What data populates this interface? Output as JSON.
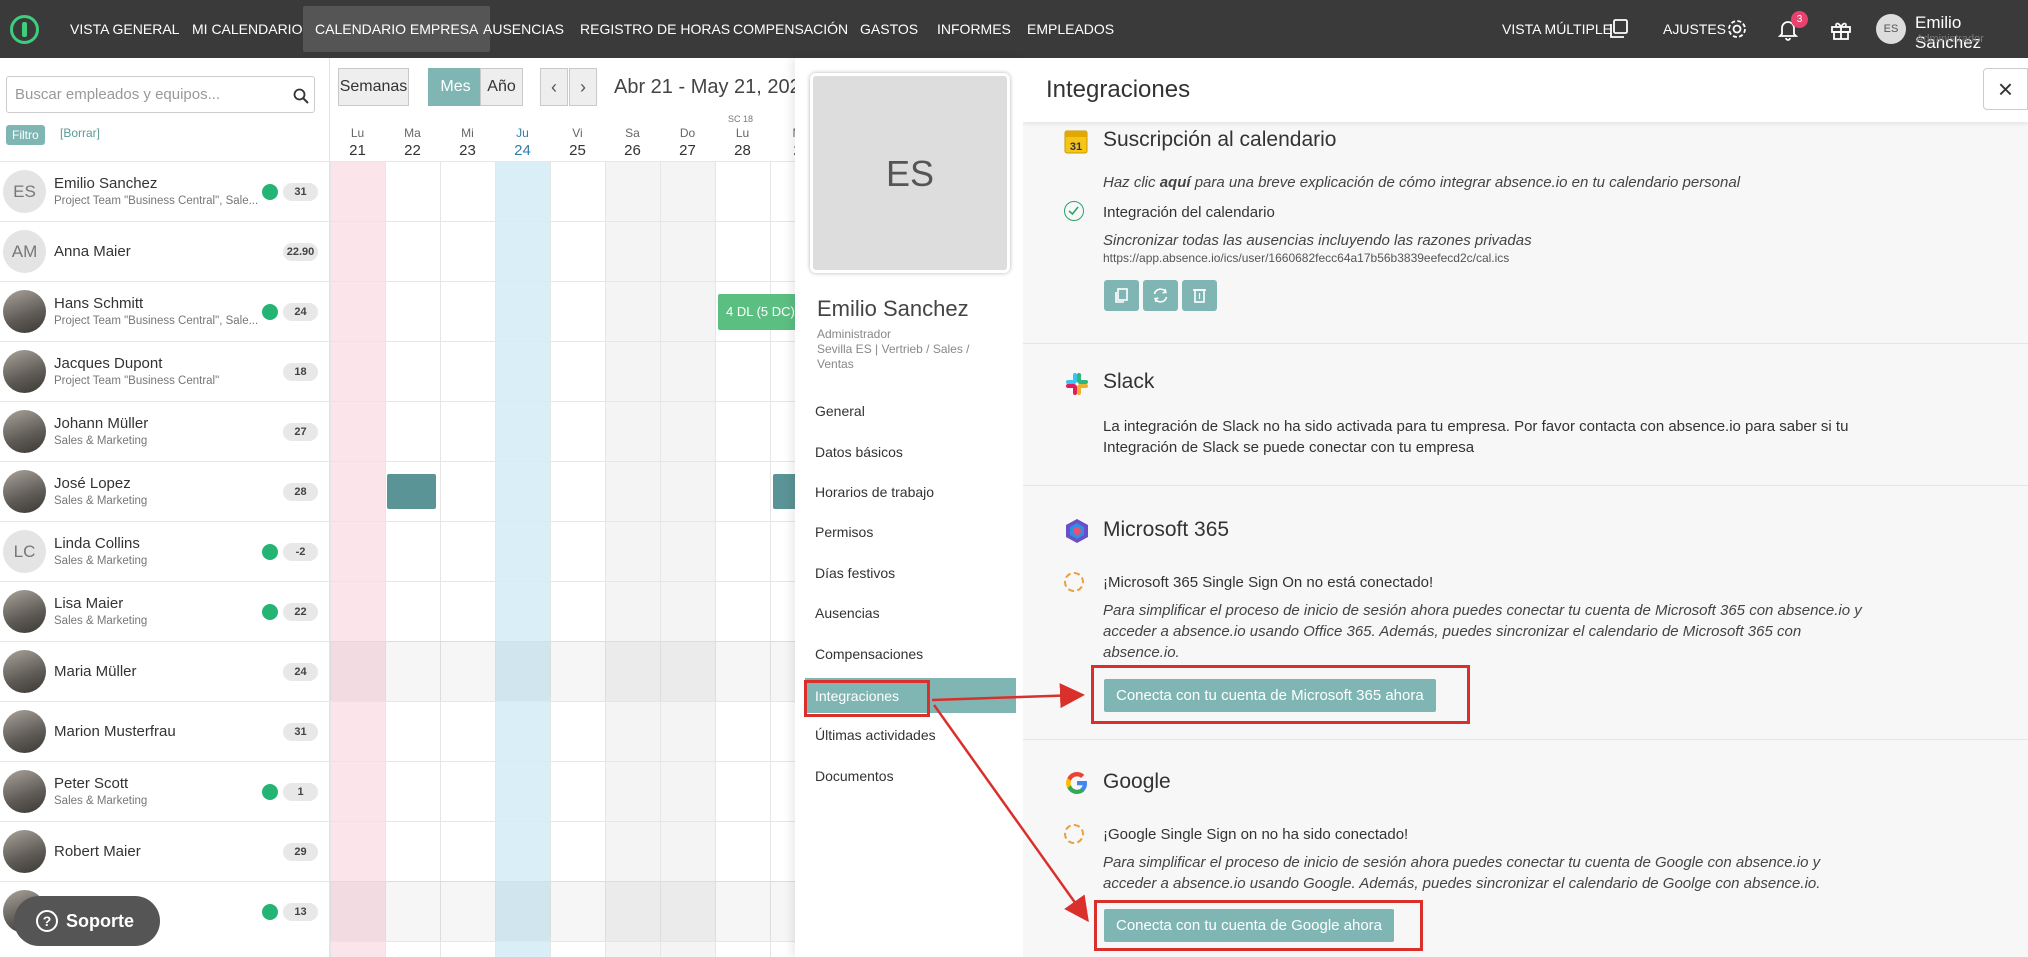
{
  "topbar": {
    "nav": [
      "VISTA GENERAL",
      "MI CALENDARIO",
      "CALENDARIO EMPRESA",
      "AUSENCIAS",
      "REGISTRO DE HORAS",
      "COMPENSACIÓN",
      "GASTOS",
      "INFORMES",
      "EMPLEADOS"
    ],
    "active_nav": "CALENDARIO EMPRESA",
    "multi_view": "VISTA MÚLTIPLE",
    "settings": "AJUSTES",
    "notifications_count": "3",
    "user_initials": "ES",
    "user_name": "Emilio Sanchez",
    "user_role": "Administrador"
  },
  "left": {
    "search_placeholder": "Buscar empleados y equipos...",
    "filter": "Filtro",
    "clear": "[Borrar]",
    "employees": [
      {
        "initials": "ES",
        "name": "Emilio Sanchez",
        "team": "Project Team \"Business Central\", Sale...",
        "count": "31",
        "dot": true,
        "photo": false
      },
      {
        "initials": "AM",
        "name": "Anna Maier",
        "team": "",
        "count": "22.90",
        "dot": false,
        "photo": false
      },
      {
        "initials": "",
        "name": "Hans Schmitt",
        "team": "Project Team \"Business Central\", Sale...",
        "count": "24",
        "dot": true,
        "photo": true
      },
      {
        "initials": "",
        "name": "Jacques Dupont",
        "team": "Project Team \"Business Central\"",
        "count": "18",
        "dot": false,
        "photo": true
      },
      {
        "initials": "",
        "name": "Johann Müller",
        "team": "Sales & Marketing",
        "count": "27",
        "dot": false,
        "photo": true
      },
      {
        "initials": "",
        "name": "José Lopez",
        "team": "Sales & Marketing",
        "count": "28",
        "dot": false,
        "photo": true
      },
      {
        "initials": "LC",
        "name": "Linda Collins",
        "team": "Sales & Marketing",
        "count": "-2",
        "dot": true,
        "photo": false
      },
      {
        "initials": "",
        "name": "Lisa Maier",
        "team": "Sales & Marketing",
        "count": "22",
        "dot": true,
        "photo": true
      },
      {
        "initials": "",
        "name": "Maria Müller",
        "team": "",
        "count": "24",
        "dot": false,
        "photo": true
      },
      {
        "initials": "",
        "name": "Marion Musterfrau",
        "team": "",
        "count": "31",
        "dot": false,
        "photo": true
      },
      {
        "initials": "",
        "name": "Peter Scott",
        "team": "Sales & Marketing",
        "count": "1",
        "dot": true,
        "photo": true
      },
      {
        "initials": "",
        "name": "Robert Maier",
        "team": "",
        "count": "29",
        "dot": false,
        "photo": true
      },
      {
        "initials": "",
        "name": "",
        "team": "",
        "count": "13",
        "dot": true,
        "photo": true
      }
    ],
    "support": "Soporte"
  },
  "calendar": {
    "views": [
      "Semanas",
      "Mes",
      "Año"
    ],
    "active_view": "Mes",
    "date_range": "Abr 21 - May 21, 202",
    "week_label": "SC 18",
    "days": [
      {
        "wd": "Lu",
        "dn": "21"
      },
      {
        "wd": "Ma",
        "dn": "22"
      },
      {
        "wd": "Mi",
        "dn": "23"
      },
      {
        "wd": "Ju",
        "dn": "24"
      },
      {
        "wd": "Vi",
        "dn": "25"
      },
      {
        "wd": "Sa",
        "dn": "26"
      },
      {
        "wd": "Do",
        "dn": "27"
      },
      {
        "wd": "Lu",
        "dn": "28"
      },
      {
        "wd": "M",
        "dn": "2"
      }
    ],
    "event_label": "4 DL (5 DC)"
  },
  "profile": {
    "initials": "ES",
    "name": "Emilio Sanchez",
    "role": "Administrador",
    "location": "Sevilla ES | Vertrieb / Sales / Ventas",
    "menu": [
      "General",
      "Datos básicos",
      "Horarios de trabajo",
      "Permisos",
      "Días festivos",
      "Ausencias",
      "Compensaciones",
      "Integraciones",
      "Últimas actividades",
      "Documentos"
    ],
    "active_menu": "Integraciones"
  },
  "integrations": {
    "title": "Integraciones",
    "calendar_sub": {
      "title": "Suscripción al calendario",
      "help_pre": "Haz clic ",
      "help_link": "aquí",
      "help_post": " para una breve explicación de cómo integrar absence.io en tu calendario personal",
      "status": "Integración del calendario",
      "sync_text": "Sincronizar todas las ausencias incluyendo las razones privadas",
      "url": "https://app.absence.io/ics/user/1660682fecc64a17b56b3839eefecd2c/cal.ics"
    },
    "slack": {
      "title": "Slack",
      "text": "La integración de Slack no ha sido activada para tu empresa. Por favor contacta con absence.io para saber si tu Integración de Slack se puede conectar con tu empresa"
    },
    "microsoft": {
      "title": "Microsoft 365",
      "status": "¡Microsoft 365 Single Sign On no está conectado!",
      "text": "Para simplificar el proceso de inicio de sesión ahora puedes conectar tu cuenta de Microsoft 365 con absence.io y acceder a absence.io usando Office 365. Además, puedes sincronizar el calendario de Microsoft 365 con absence.io.",
      "button": "Conecta con tu cuenta de Microsoft 365 ahora"
    },
    "google": {
      "title": "Google",
      "status": "¡Google Single Sign on no ha sido conectado!",
      "text": "Para simplificar el proceso de inicio de sesión ahora puedes conectar tu cuenta de Google con absence.io y acceder a absence.io usando Google. Además, puedes sincronizar el calendario de Goolge con absence.io.",
      "button": "Conecta con tu cuenta de Google ahora"
    }
  },
  "colors": {
    "accent": "#7fb6b3",
    "topbar": "#3a3a3a",
    "annotation": "#d9302c"
  }
}
